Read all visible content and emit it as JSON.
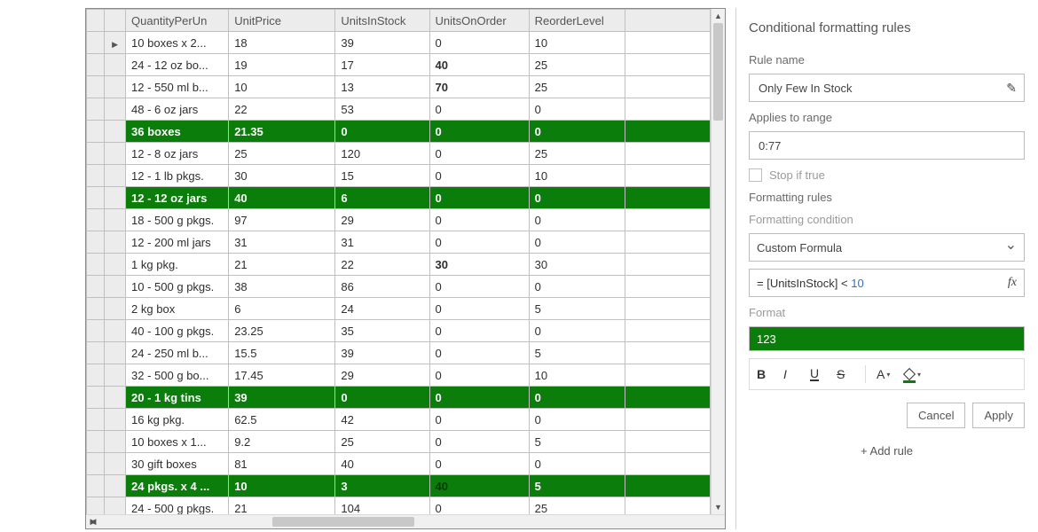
{
  "grid": {
    "headers": [
      "QuantityPerUn",
      "UnitPrice",
      "UnitsInStock",
      "UnitsOnOrder",
      "ReorderLevel"
    ],
    "rows": [
      {
        "cells": [
          "10 boxes x 2...",
          "18",
          "39",
          "0",
          "10"
        ],
        "hl": false,
        "indicator": true
      },
      {
        "cells": [
          "24 - 12 oz bo...",
          "19",
          "17",
          "40",
          "25"
        ],
        "hl": false,
        "boldCols": [
          3
        ]
      },
      {
        "cells": [
          "12 - 550 ml b...",
          "10",
          "13",
          "70",
          "25"
        ],
        "hl": false,
        "boldCols": [
          3
        ]
      },
      {
        "cells": [
          "48 - 6 oz jars",
          "22",
          "53",
          "0",
          "0"
        ],
        "hl": false
      },
      {
        "cells": [
          "36 boxes",
          "21.35",
          "0",
          "0",
          "0"
        ],
        "hl": true
      },
      {
        "cells": [
          "12 - 8 oz jars",
          "25",
          "120",
          "0",
          "25"
        ],
        "hl": false
      },
      {
        "cells": [
          "12 - 1 lb pkgs.",
          "30",
          "15",
          "0",
          "10"
        ],
        "hl": false
      },
      {
        "cells": [
          "12 - 12 oz jars",
          "40",
          "6",
          "0",
          "0"
        ],
        "hl": true
      },
      {
        "cells": [
          "18 - 500 g pkgs.",
          "97",
          "29",
          "0",
          "0"
        ],
        "hl": false
      },
      {
        "cells": [
          "12 - 200 ml jars",
          "31",
          "31",
          "0",
          "0"
        ],
        "hl": false
      },
      {
        "cells": [
          "1 kg pkg.",
          "21",
          "22",
          "30",
          "30"
        ],
        "hl": false,
        "boldCols": [
          3
        ]
      },
      {
        "cells": [
          "10 - 500 g pkgs.",
          "38",
          "86",
          "0",
          "0"
        ],
        "hl": false
      },
      {
        "cells": [
          "2 kg box",
          "6",
          "24",
          "0",
          "5"
        ],
        "hl": false
      },
      {
        "cells": [
          "40 - 100 g pkgs.",
          "23.25",
          "35",
          "0",
          "0"
        ],
        "hl": false
      },
      {
        "cells": [
          "24 - 250 ml b...",
          "15.5",
          "39",
          "0",
          "5"
        ],
        "hl": false
      },
      {
        "cells": [
          "32 - 500 g bo...",
          "17.45",
          "29",
          "0",
          "10"
        ],
        "hl": false
      },
      {
        "cells": [
          "20 - 1 kg tins",
          "39",
          "0",
          "0",
          "0"
        ],
        "hl": true
      },
      {
        "cells": [
          "16 kg pkg.",
          "62.5",
          "42",
          "0",
          "0"
        ],
        "hl": false
      },
      {
        "cells": [
          "10 boxes x 1...",
          "9.2",
          "25",
          "0",
          "5"
        ],
        "hl": false
      },
      {
        "cells": [
          "30 gift boxes",
          "81",
          "40",
          "0",
          "0"
        ],
        "hl": false
      },
      {
        "cells": [
          "24 pkgs. x 4 ...",
          "10",
          "3",
          "40",
          "5"
        ],
        "hl": true,
        "darkCols": [
          3
        ]
      },
      {
        "cells": [
          "24 - 500 g pkgs.",
          "21",
          "104",
          "0",
          "25"
        ],
        "hl": false
      }
    ]
  },
  "sidepanel": {
    "title": "Conditional formatting rules",
    "rule_name_label": "Rule name",
    "rule_name": "Only Few In Stock",
    "applies_label": "Applies to range",
    "applies_value": "0:77",
    "stop_if_true": "Stop if true",
    "formatting_rules_label": "Formatting rules",
    "formatting_condition_label": "Formatting condition",
    "condition_value": "Custom Formula",
    "formula_prefix": "= [UnitsInStock] < ",
    "formula_number": "10",
    "format_label": "Format",
    "preview_text": "123",
    "cancel": "Cancel",
    "apply": "Apply",
    "add_rule": "+ Add rule"
  }
}
